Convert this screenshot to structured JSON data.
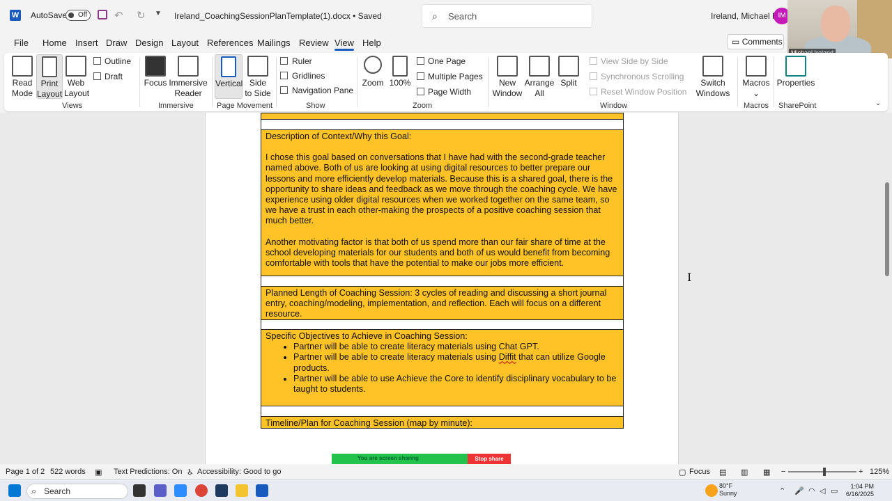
{
  "titlebar": {
    "autosave_label": "AutoSave",
    "autosave_state": "Off",
    "doc_title": "Ireland_CoachingSessionPlanTemplate(1).docx • Saved",
    "search_placeholder": "Search",
    "user_name": "Ireland, Michael R",
    "user_initials": "IM",
    "webcam_label": "Michael Ireland"
  },
  "menu": {
    "tabs": [
      "File",
      "Home",
      "Insert",
      "Draw",
      "Design",
      "Layout",
      "References",
      "Mailings",
      "Review",
      "View",
      "Help"
    ],
    "active_tab": "View",
    "comments_label": "Comments"
  },
  "ribbon": {
    "views": {
      "read_mode": "Read\nMode",
      "read_mode_1": "Read",
      "read_mode_2": "Mode",
      "print_layout_1": "Print",
      "print_layout_2": "Layout",
      "web_layout_1": "Web",
      "web_layout_2": "Layout",
      "outline": "Outline",
      "draft": "Draft",
      "group": "Views"
    },
    "immersive": {
      "focus": "Focus",
      "reader_1": "Immersive",
      "reader_2": "Reader",
      "group": "Immersive"
    },
    "page_movement": {
      "vertical": "Vertical",
      "side_1": "Side",
      "side_2": "to Side",
      "group": "Page Movement"
    },
    "show": {
      "ruler": "Ruler",
      "gridlines": "Gridlines",
      "navigation_pane": "Navigation Pane",
      "group": "Show"
    },
    "zoom": {
      "zoom": "Zoom",
      "hundred": "100%",
      "one_page": "One Page",
      "multiple_pages": "Multiple Pages",
      "page_width": "Page Width",
      "group": "Zoom"
    },
    "window": {
      "new_1": "New",
      "new_2": "Window",
      "arrange_1": "Arrange",
      "arrange_2": "All",
      "split": "Split",
      "view_side_by_side": "View Side by Side",
      "synchronous_scrolling": "Synchronous Scrolling",
      "reset_window_position": "Reset Window Position",
      "switch_1": "Switch",
      "switch_2": "Windows",
      "group": "Window"
    },
    "macros": {
      "macros": "Macros",
      "group": "Macros"
    },
    "sharepoint": {
      "properties": "Properties",
      "group": "SharePoint"
    }
  },
  "document": {
    "context_heading": "Description of Context/Why this Goal:",
    "context_p1": "I chose this goal based on conversations that I have had with the second-grade teacher named above. Both of us are looking at using digital resources to better prepare our lessons and more efficiently develop materials. Because this is a shared goal, there is the opportunity to share ideas and feedback as we move through the coaching cycle. We have experience using older digital resources when we worked together on the same team, so we have a trust in each other-making the prospects of a positive coaching session that much better.",
    "context_p2": "Another motivating factor is that both of us spend more than our fair share of time at the school developing materials for our students and both of us would benefit from becoming comfortable with tools that have the potential to make our jobs more efficient.",
    "length_text": "Planned Length of Coaching Session: 3 cycles of reading and discussing a short journal entry, coaching/modeling, implementation, and reflection. Each will focus on a different resource.",
    "objectives_heading": "Specific Objectives to Achieve in Coaching Session:",
    "objective_1": "Partner will be able to create literacy materials using Chat GPT.",
    "objective_2_pre": "Partner will be able to create literacy materials using ",
    "objective_2_word": "Diffit",
    "objective_2_post": " that can utilize Google products.",
    "objective_3": "Partner will be able to use Achieve the Core to identify disciplinary vocabulary to be taught to students.",
    "timeline_heading": "Timeline/Plan for Coaching Session (map by minute):"
  },
  "share_bar": {
    "text": "You are screen sharing",
    "stop": "Stop share"
  },
  "statusbar": {
    "page": "Page 1 of 2",
    "words": "522 words",
    "text_predictions": "Text Predictions: On",
    "accessibility": "Accessibility: Good to go",
    "focus": "Focus",
    "zoom": "125%"
  },
  "taskbar": {
    "search": "Search",
    "weather_temp": "80°F",
    "weather_desc": "Sunny",
    "time": "1:04 PM",
    "date": "6/16/2025"
  }
}
